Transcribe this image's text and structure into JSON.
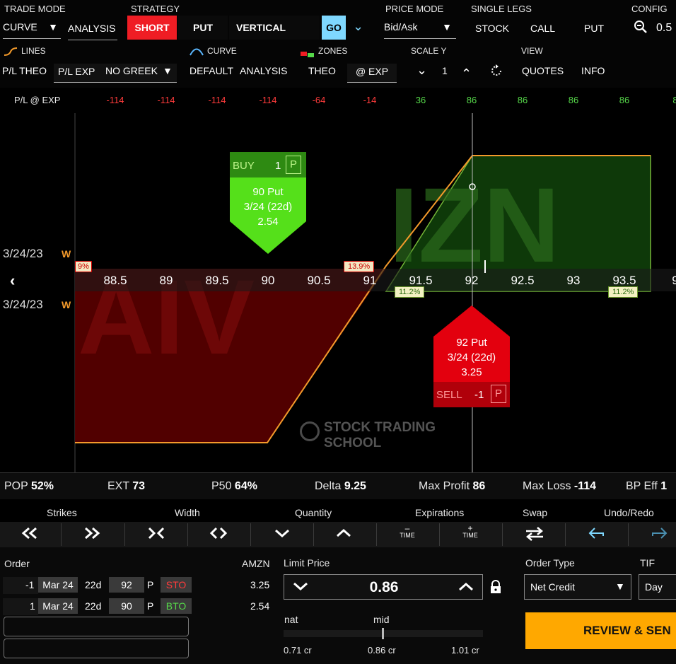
{
  "toolbar": {
    "trade_mode_label": "TRADE MODE",
    "trade_mode_value": "CURVE",
    "analysis_btn": "ANALYSIS",
    "strategy_label": "STRATEGY",
    "short_btn": "SHORT",
    "put_btn": "PUT",
    "vertical_btn": "VERTICAL",
    "go_btn": "GO",
    "price_mode_label": "PRICE MODE",
    "price_mode_value": "Bid/Ask",
    "single_legs_label": "SINGLE LEGS",
    "stock_btn": "STOCK",
    "call_btn": "CALL",
    "put_leg_btn": "PUT",
    "config_label": "CONFIG",
    "zoom_value": "0.5"
  },
  "toolbar2": {
    "lines_label": "LINES",
    "pl_theo_btn": "P/L THEO",
    "pl_exp_btn": "P/L EXP",
    "greek_value": "NO GREEK",
    "curve_label": "CURVE",
    "default_btn": "DEFAULT",
    "analysis_btn": "ANALYSIS",
    "zones_label": "ZONES",
    "theo_btn": "THEO",
    "at_exp_btn": "@ EXP",
    "scale_y_label": "SCALE Y",
    "scale_value": "1",
    "view_label": "VIEW",
    "quotes_btn": "QUOTES",
    "info_btn": "INFO"
  },
  "pl_row": {
    "label": "P/L @ EXP",
    "values": [
      "-114",
      "-114",
      "-114",
      "-114",
      "-64",
      "-14",
      "36",
      "86",
      "86",
      "86",
      "86",
      "8"
    ]
  },
  "colors": {
    "loss": "#ff3b3b",
    "profit": "#56d84a",
    "short": "#ef1d24",
    "go": "#7fd8ff",
    "review": "#ffa800"
  },
  "chart_data": {
    "type": "area",
    "xlabel": "",
    "ylabel": "",
    "strikes": [
      "88.5",
      "89",
      "89.5",
      "90",
      "90.5",
      "91",
      "91.5",
      "92",
      "92.5",
      "93",
      "93.5",
      "9"
    ],
    "x": [
      88.2,
      90.0,
      92.0,
      93.8
    ],
    "y": [
      -114,
      -114,
      86,
      86
    ],
    "date_top": "3/24/23",
    "date_bottom": "3/24/23",
    "week_marker": "W",
    "iv_labels": [
      "9%",
      "13.9%",
      "11.2%",
      "11.2%"
    ],
    "watermark": "STOCK TRADING SCHOOL",
    "buy_leg": {
      "side": "BUY",
      "qty": "1",
      "type": "P",
      "strike": "90 Put",
      "expiry": "3/24 (22d)",
      "price": "2.54"
    },
    "sell_leg": {
      "side": "SELL",
      "qty": "-1",
      "type": "P",
      "strike": "92 Put",
      "expiry": "3/24 (22d)",
      "price": "3.25"
    }
  },
  "stats": {
    "pop_label": "POP",
    "pop_value": "52%",
    "ext_label": "EXT",
    "ext_value": "73",
    "p50_label": "P50",
    "p50_value": "64%",
    "delta_label": "Delta",
    "delta_value": "9.25",
    "max_profit_label": "Max Profit",
    "max_profit_value": "86",
    "max_loss_label": "Max Loss",
    "max_loss_value": "-114",
    "bp_label": "BP Eff",
    "bp_value": "1"
  },
  "controls": {
    "strikes": "Strikes",
    "width": "Width",
    "quantity": "Quantity",
    "expirations": "Expirations",
    "swap": "Swap",
    "undo_redo": "Undo/Redo",
    "time_minus": "TIME",
    "time_plus": "TIME"
  },
  "order": {
    "title": "Order",
    "symbol": "AMZN",
    "legs": [
      {
        "qty": "-1",
        "exp": "Mar 24",
        "dte": "22d",
        "strike": "92",
        "type": "P",
        "action": "STO",
        "price": "3.25"
      },
      {
        "qty": "1",
        "exp": "Mar 24",
        "dte": "22d",
        "strike": "90",
        "type": "P",
        "action": "BTO",
        "price": "2.54"
      }
    ],
    "limit_label": "Limit Price",
    "limit_value": "0.86",
    "nat_label": "nat",
    "mid_label": "mid",
    "nat_value": "0.71 cr",
    "mid_value": "0.86 cr",
    "far_value": "1.01 cr",
    "order_type_label": "Order Type",
    "order_type_value": "Net Credit",
    "tif_label": "TIF",
    "tif_value": "Day",
    "review_btn": "REVIEW & SEN"
  }
}
